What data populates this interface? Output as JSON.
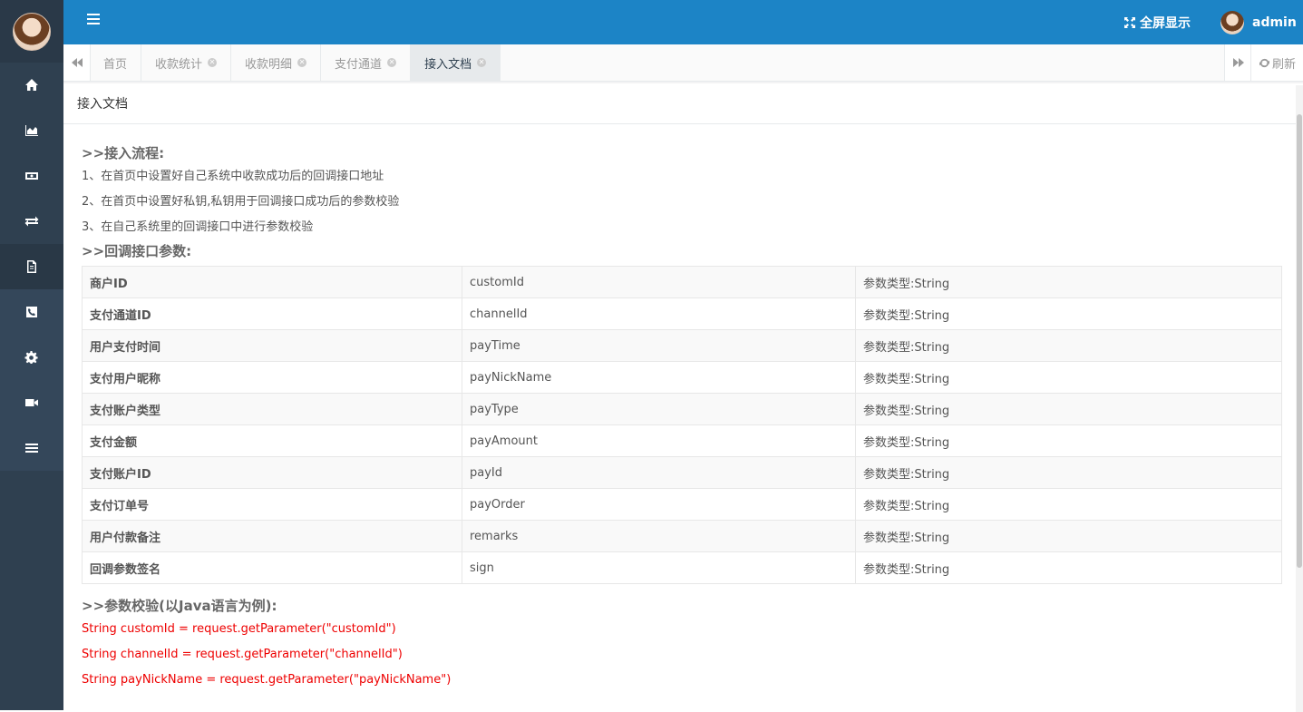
{
  "sidebar": {
    "items": [
      {
        "icon": "home-icon"
      },
      {
        "icon": "area-chart-icon"
      },
      {
        "icon": "money-icon"
      },
      {
        "icon": "exchange-icon"
      },
      {
        "icon": "document-icon"
      },
      {
        "icon": "phone-icon"
      },
      {
        "icon": "gear-icon"
      },
      {
        "icon": "video-camera-icon"
      },
      {
        "icon": "list-icon"
      }
    ]
  },
  "topbar": {
    "fullscreen_label": "全屏显示",
    "username": "admin",
    "accent_color": "#1c84c6"
  },
  "tabs": [
    {
      "label": "首页",
      "closable": false,
      "active": false
    },
    {
      "label": "收款统计",
      "closable": true,
      "active": false
    },
    {
      "label": "收款明细",
      "closable": true,
      "active": false
    },
    {
      "label": "支付通道",
      "closable": true,
      "active": false
    },
    {
      "label": "接入文档",
      "closable": true,
      "active": true
    }
  ],
  "refresh_label": "刷新",
  "panel": {
    "title": "接入文档",
    "section1_title": ">>接入流程:",
    "steps": [
      "1、在首页中设置好自己系统中收款成功后的回调接口地址",
      "2、在首页中设置好私钥,私钥用于回调接口成功后的参数校验",
      "3、在自己系统里的回调接口中进行参数校验"
    ],
    "section2_title": ">>回调接口参数:",
    "params": [
      {
        "name": "商户ID",
        "key": "customId",
        "type": "参数类型:String"
      },
      {
        "name": "支付通道ID",
        "key": "channelId",
        "type": "参数类型:String"
      },
      {
        "name": "用户支付时间",
        "key": "payTime",
        "type": "参数类型:String"
      },
      {
        "name": "支付用户昵称",
        "key": "payNickName",
        "type": "参数类型:String"
      },
      {
        "name": "支付账户类型",
        "key": "payType",
        "type": "参数类型:String"
      },
      {
        "name": "支付金额",
        "key": "payAmount",
        "type": "参数类型:String"
      },
      {
        "name": "支付账户ID",
        "key": "payId",
        "type": "参数类型:String"
      },
      {
        "name": "支付订单号",
        "key": "payOrder",
        "type": "参数类型:String"
      },
      {
        "name": "用户付款备注",
        "key": "remarks",
        "type": "参数类型:String"
      },
      {
        "name": "回调参数签名",
        "key": "sign",
        "type": "参数类型:String"
      }
    ],
    "section3_title": ">>参数校验(以Java语言为例):",
    "code_lines": [
      "String customId = request.getParameter(\"customId\")",
      "String channelId = request.getParameter(\"channelId\")",
      "String payNickName = request.getParameter(\"payNickName\")"
    ]
  }
}
